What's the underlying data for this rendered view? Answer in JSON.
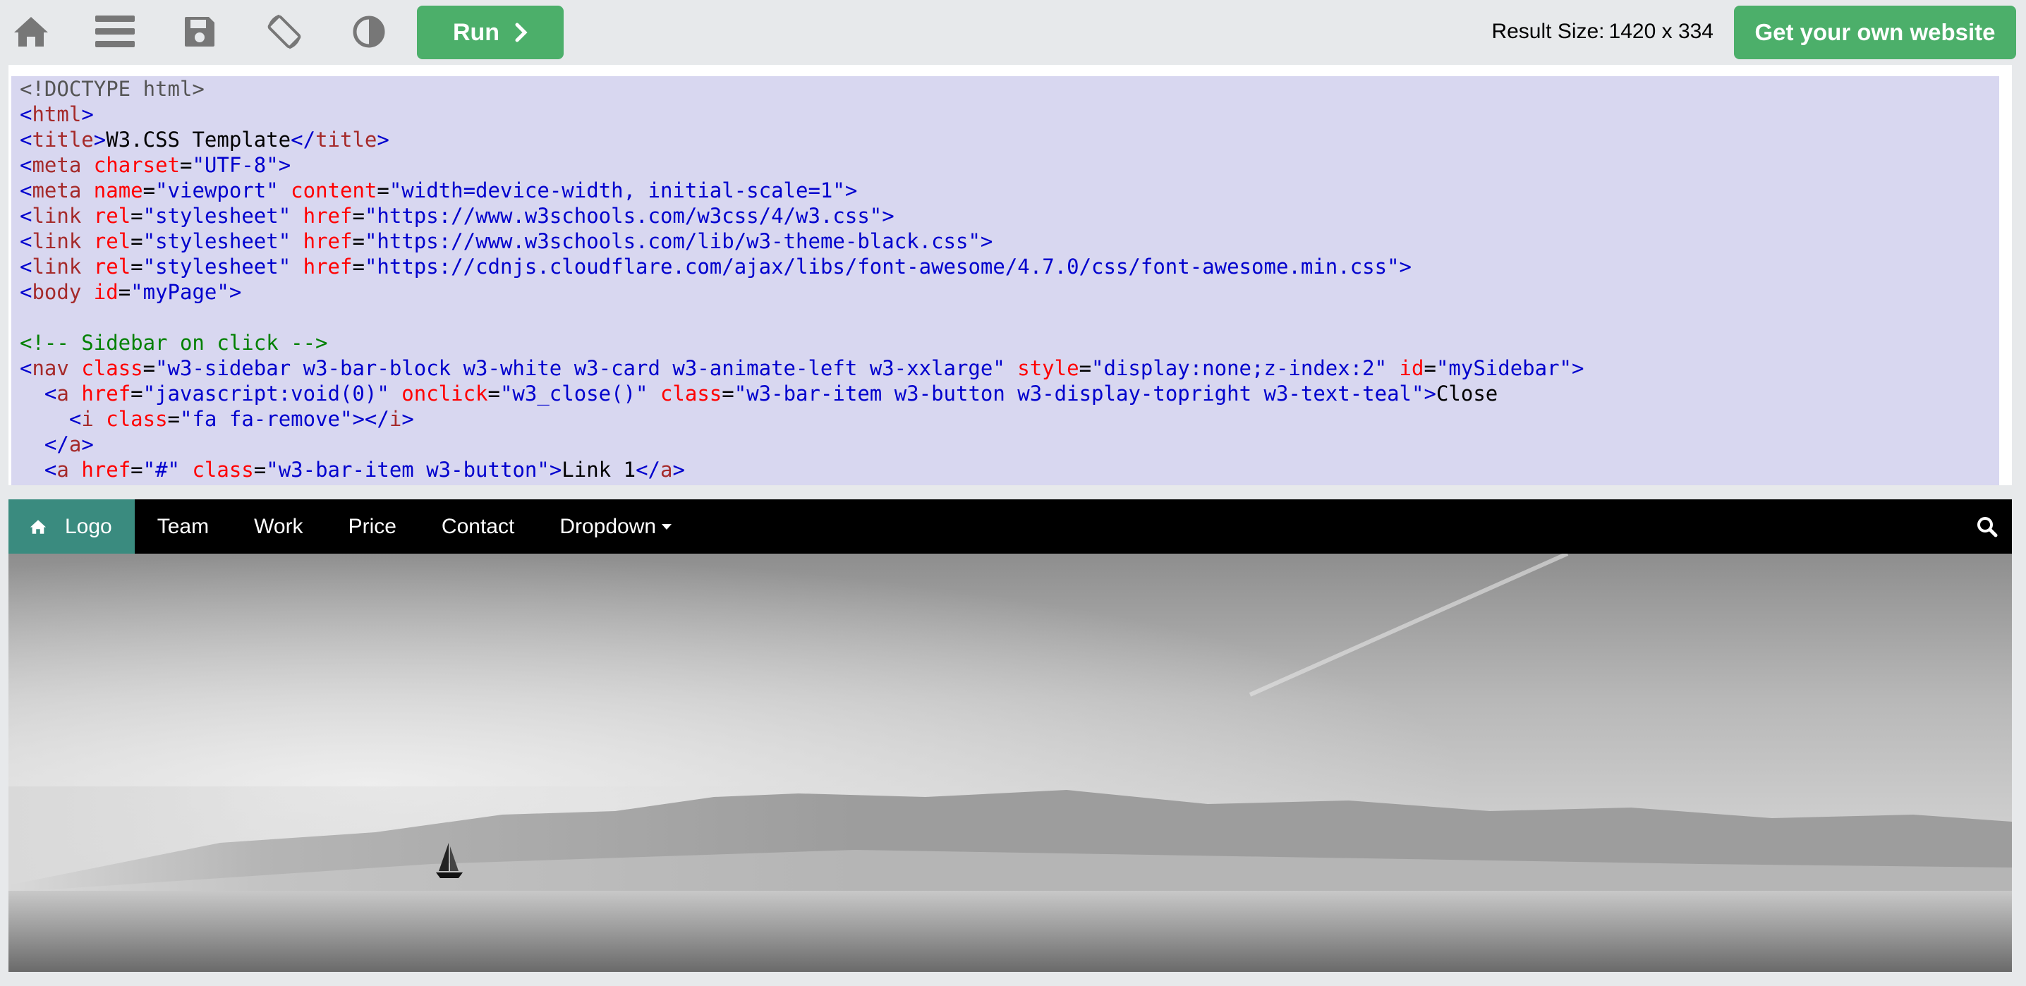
{
  "toolbar": {
    "icons": [
      "home-icon",
      "menu-icon",
      "save-icon",
      "rotate-icon",
      "contrast-icon"
    ],
    "run_label": "Run",
    "result_size_label": "Result Size:",
    "result_size_value": "1420 x 334",
    "own_website_label": "Get your own website",
    "accent_color": "#4caf6a"
  },
  "editor": {
    "lines": [
      [
        [
          "doc",
          "<!DOCTYPE html>"
        ]
      ],
      [
        [
          "tag",
          "<"
        ],
        [
          "name",
          "html"
        ],
        [
          "tag",
          ">"
        ]
      ],
      [
        [
          "tag",
          "<"
        ],
        [
          "name",
          "title"
        ],
        [
          "tag",
          ">"
        ],
        [
          "txt",
          "W3.CSS Template"
        ],
        [
          "tag",
          "</"
        ],
        [
          "name",
          "title"
        ],
        [
          "tag",
          ">"
        ]
      ],
      [
        [
          "tag",
          "<"
        ],
        [
          "name",
          "meta "
        ],
        [
          "attr",
          "charset"
        ],
        [
          "txt",
          "="
        ],
        [
          "val",
          "\"UTF-8\""
        ],
        [
          "tag",
          ">"
        ]
      ],
      [
        [
          "tag",
          "<"
        ],
        [
          "name",
          "meta "
        ],
        [
          "attr",
          "name"
        ],
        [
          "txt",
          "="
        ],
        [
          "val",
          "\"viewport\" "
        ],
        [
          "attr",
          "content"
        ],
        [
          "txt",
          "="
        ],
        [
          "val",
          "\"width=device-width, initial-scale=1\""
        ],
        [
          "tag",
          ">"
        ]
      ],
      [
        [
          "tag",
          "<"
        ],
        [
          "name",
          "link "
        ],
        [
          "attr",
          "rel"
        ],
        [
          "txt",
          "="
        ],
        [
          "val",
          "\"stylesheet\" "
        ],
        [
          "attr",
          "href"
        ],
        [
          "txt",
          "="
        ],
        [
          "val",
          "\"https://www.w3schools.com/w3css/4/w3.css\""
        ],
        [
          "tag",
          ">"
        ]
      ],
      [
        [
          "tag",
          "<"
        ],
        [
          "name",
          "link "
        ],
        [
          "attr",
          "rel"
        ],
        [
          "txt",
          "="
        ],
        [
          "val",
          "\"stylesheet\" "
        ],
        [
          "attr",
          "href"
        ],
        [
          "txt",
          "="
        ],
        [
          "val",
          "\"https://www.w3schools.com/lib/w3-theme-black.css\""
        ],
        [
          "tag",
          ">"
        ]
      ],
      [
        [
          "tag",
          "<"
        ],
        [
          "name",
          "link "
        ],
        [
          "attr",
          "rel"
        ],
        [
          "txt",
          "="
        ],
        [
          "val",
          "\"stylesheet\" "
        ],
        [
          "attr",
          "href"
        ],
        [
          "txt",
          "="
        ],
        [
          "val",
          "\"https://cdnjs.cloudflare.com/ajax/libs/font-awesome/4.7.0/css/font-awesome.min.css\""
        ],
        [
          "tag",
          ">"
        ]
      ],
      [
        [
          "tag",
          "<"
        ],
        [
          "name",
          "body "
        ],
        [
          "attr",
          "id"
        ],
        [
          "txt",
          "="
        ],
        [
          "val",
          "\"myPage\""
        ],
        [
          "tag",
          ">"
        ]
      ],
      [],
      [
        [
          "com",
          "<!-- Sidebar on click -->"
        ]
      ],
      [
        [
          "tag",
          "<"
        ],
        [
          "name",
          "nav "
        ],
        [
          "attr",
          "class"
        ],
        [
          "txt",
          "="
        ],
        [
          "val",
          "\"w3-sidebar w3-bar-block w3-white w3-card w3-animate-left w3-xxlarge\" "
        ],
        [
          "attr",
          "style"
        ],
        [
          "txt",
          "="
        ],
        [
          "val",
          "\"display:none;z-index:2\" "
        ],
        [
          "attr",
          "id"
        ],
        [
          "txt",
          "="
        ],
        [
          "val",
          "\"mySidebar\""
        ],
        [
          "tag",
          ">"
        ]
      ],
      [
        [
          "txt",
          "  "
        ],
        [
          "tag",
          "<"
        ],
        [
          "name",
          "a "
        ],
        [
          "attr",
          "href"
        ],
        [
          "txt",
          "="
        ],
        [
          "val",
          "\"javascript:void(0)\" "
        ],
        [
          "attr",
          "onclick"
        ],
        [
          "txt",
          "="
        ],
        [
          "val",
          "\"w3_close()\" "
        ],
        [
          "attr",
          "class"
        ],
        [
          "txt",
          "="
        ],
        [
          "val",
          "\"w3-bar-item w3-button w3-display-topright w3-text-teal\""
        ],
        [
          "tag",
          ">"
        ],
        [
          "txt",
          "Close"
        ]
      ],
      [
        [
          "txt",
          "    "
        ],
        [
          "tag",
          "<"
        ],
        [
          "name",
          "i "
        ],
        [
          "attr",
          "class"
        ],
        [
          "txt",
          "="
        ],
        [
          "val",
          "\"fa fa-remove\""
        ],
        [
          "tag",
          "></"
        ],
        [
          "name",
          "i"
        ],
        [
          "tag",
          ">"
        ]
      ],
      [
        [
          "txt",
          "  "
        ],
        [
          "tag",
          "</"
        ],
        [
          "name",
          "a"
        ],
        [
          "tag",
          ">"
        ]
      ],
      [
        [
          "txt",
          "  "
        ],
        [
          "tag",
          "<"
        ],
        [
          "name",
          "a "
        ],
        [
          "attr",
          "href"
        ],
        [
          "txt",
          "="
        ],
        [
          "val",
          "\"#\" "
        ],
        [
          "attr",
          "class"
        ],
        [
          "txt",
          "="
        ],
        [
          "val",
          "\"w3-bar-item w3-button\""
        ],
        [
          "tag",
          ">"
        ],
        [
          "txt",
          "Link 1"
        ],
        [
          "tag",
          "</"
        ],
        [
          "name",
          "a"
        ],
        [
          "tag",
          ">"
        ]
      ]
    ]
  },
  "result": {
    "nav": {
      "logo_label": "Logo",
      "items": [
        "Team",
        "Work",
        "Price",
        "Contact"
      ],
      "dropdown_label": "Dropdown",
      "logo_bg": "#3a8b7f"
    }
  }
}
